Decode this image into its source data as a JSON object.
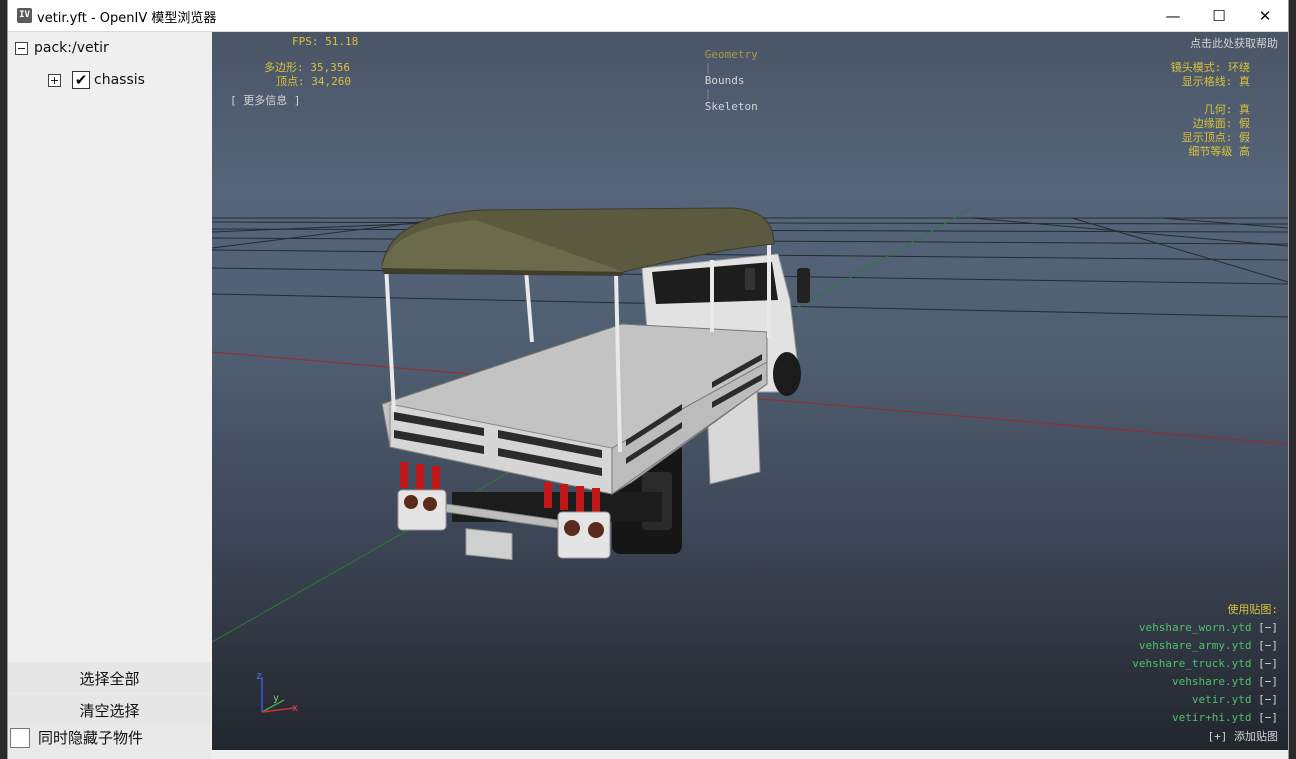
{
  "window": {
    "title": "vetir.yft - OpenIV 模型浏览器",
    "icon_text": "IV"
  },
  "controls": {
    "minimize": "—",
    "maximize": "☐",
    "close": "✕"
  },
  "tree": {
    "root": {
      "label": "pack:/vetir",
      "expanded": true
    },
    "children": [
      {
        "label": "chassis",
        "checked": true,
        "expanded": false
      }
    ]
  },
  "sidebar_buttons": {
    "select_all": "选择全部",
    "clear_selection": "清空选择"
  },
  "hide_children": {
    "label": "同时隐藏子物件",
    "checked": false
  },
  "hud": {
    "fps": "FPS: 51.18",
    "polygons": "多边形: 35,356",
    "vertices": "顶点: 34,260",
    "more_info": "[ 更多信息 ]",
    "modes": [
      "Geometry",
      "Bounds",
      "Skeleton"
    ],
    "mode_separator": "|",
    "active_mode": "Geometry",
    "help": "点击此处获取帮助",
    "camera_mode": "镜头模式: 环绕",
    "show_grid": "显示格线: 真",
    "geometry": "几何: 真",
    "edges": "边缘面: 假",
    "show_vertices": "显示顶点: 假",
    "lod": "细节等级 高",
    "textures_title": "使用贴图:",
    "textures": [
      "vehshare_worn.ytd",
      "vehshare_army.ytd",
      "vehshare_truck.ytd",
      "vehshare.ytd",
      "vetir.ytd",
      "vetir+hi.ytd"
    ],
    "texture_remove": "[−]",
    "add_texture": "[+] 添加贴图",
    "axis_z": "z",
    "axis_y": "y"
  },
  "colors": {
    "hud_yellow": "#d9c23a",
    "hud_green": "#4fc06a",
    "canopy": "#6b6a4b",
    "grid": "#1c1c1c"
  }
}
